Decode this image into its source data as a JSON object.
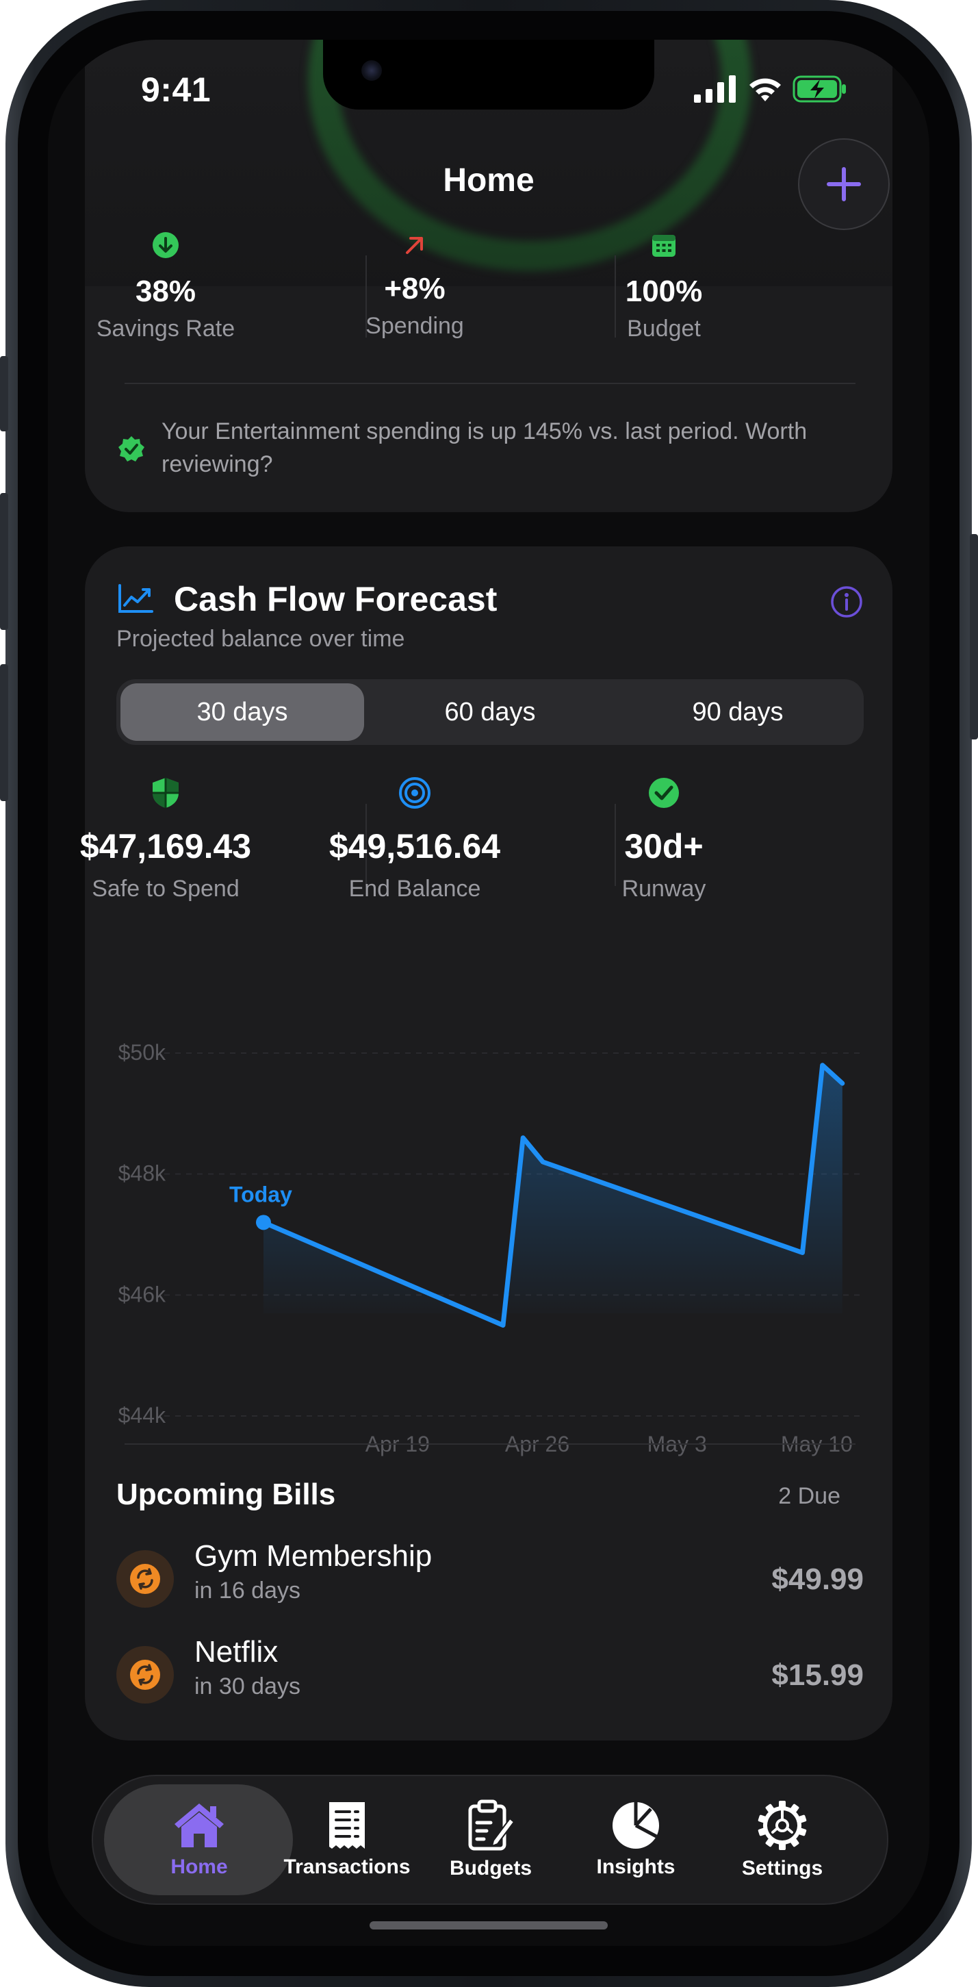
{
  "status_bar": {
    "time": "9:41"
  },
  "header": {
    "title": "Home"
  },
  "summary": {
    "stats": [
      {
        "icon": "arrow-down-circle-icon",
        "value": "38%",
        "label": "Savings Rate"
      },
      {
        "icon": "arrow-up-right-icon",
        "value": "+8%",
        "label": "Spending"
      },
      {
        "icon": "calendar-icon",
        "value": "100%",
        "label": "Budget"
      }
    ],
    "insight": "Your Entertainment spending is up 145% vs. last period. Worth reviewing?"
  },
  "forecast": {
    "title": "Cash Flow Forecast",
    "subtitle": "Projected balance over time",
    "ranges": [
      "30 days",
      "60 days",
      "90 days"
    ],
    "selected_range": "30 days",
    "metrics": [
      {
        "icon": "shield-icon",
        "value": "$47,169.43",
        "label": "Safe to Spend"
      },
      {
        "icon": "target-icon",
        "value": "$49,516.64",
        "label": "End Balance"
      },
      {
        "icon": "checkmark-circle-icon",
        "value": "30d+",
        "label": "Runway"
      }
    ]
  },
  "chart_data": {
    "type": "area",
    "annotation": "Today",
    "x_ticks": [
      "Apr 19",
      "Apr 26",
      "May 3",
      "May 10"
    ],
    "y_ticks": [
      "$50k",
      "$48k",
      "$46k",
      "$44k"
    ],
    "ylim": [
      44000,
      50000
    ],
    "x": [
      "Apr 14",
      "Apr 26",
      "Apr 27",
      "Apr 28",
      "May 11",
      "May 12",
      "May 13"
    ],
    "values": [
      47200,
      45500,
      48600,
      48200,
      46700,
      49800,
      49500
    ],
    "grid": true
  },
  "bills": {
    "title": "Upcoming Bills",
    "due_count": "2 Due",
    "items": [
      {
        "name": "Gym Membership",
        "due": "in 16 days",
        "amount": "$49.99"
      },
      {
        "name": "Netflix",
        "due": "in 30 days",
        "amount": "$15.99"
      }
    ]
  },
  "tabs": [
    {
      "label": "Home",
      "icon": "house-icon",
      "active": true
    },
    {
      "label": "Transactions",
      "icon": "receipt-icon",
      "active": false
    },
    {
      "label": "Budgets",
      "icon": "clipboard-pencil-icon",
      "active": false
    },
    {
      "label": "Insights",
      "icon": "pie-chart-icon",
      "active": false
    },
    {
      "label": "Settings",
      "icon": "gear-icon",
      "active": false
    }
  ],
  "colors": {
    "accent": "#8a6cf0",
    "chart_line": "#1e8ff5",
    "positive": "#34c759",
    "negative": "#e0443a",
    "bill_icon": "#f08a24"
  }
}
